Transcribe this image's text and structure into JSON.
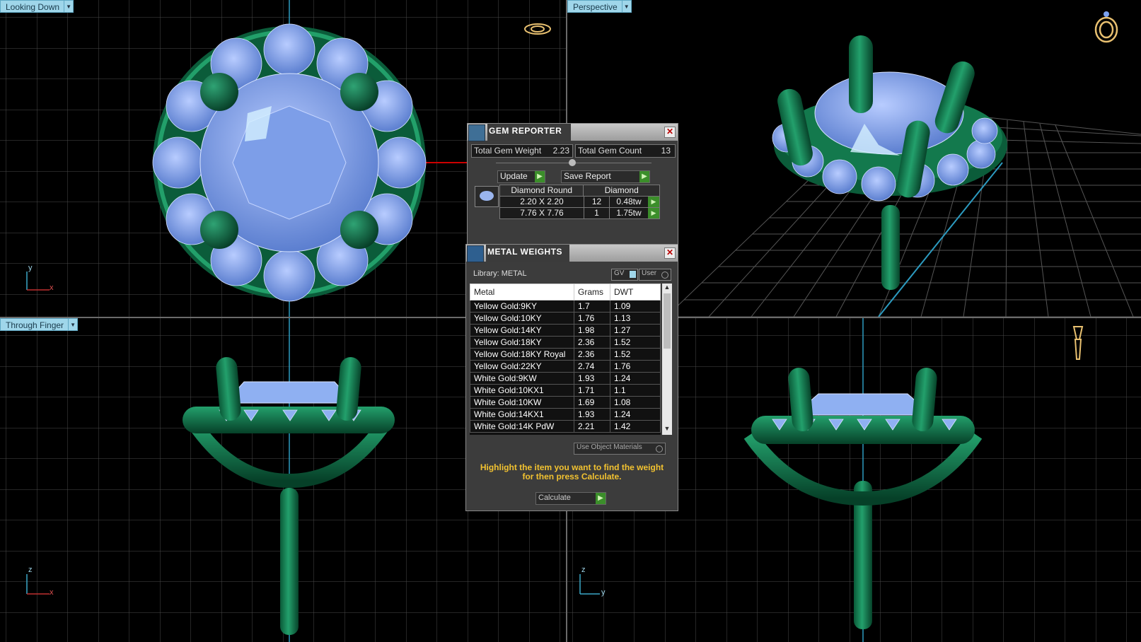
{
  "viewports": {
    "top_left": {
      "label": "Looking Down",
      "axes": [
        "y",
        "x"
      ]
    },
    "top_right": {
      "label": "Perspective"
    },
    "bottom_left": {
      "label": "Through Finger",
      "axes": [
        "z",
        "x"
      ]
    },
    "bottom_right": {
      "axes": [
        "z",
        "y"
      ]
    }
  },
  "gem_reporter": {
    "title": "GEM REPORTER",
    "total_weight_label": "Total Gem Weight",
    "total_weight_value": "2.23",
    "total_count_label": "Total Gem Count",
    "total_count_value": "13",
    "update_label": "Update",
    "save_report_label": "Save Report",
    "header_shape": "Diamond Round",
    "header_material": "Diamond",
    "rows": [
      {
        "size": "2.20 X 2.20",
        "count": "12",
        "weight": "0.48tw"
      },
      {
        "size": "7.76 X 7.76",
        "count": "1",
        "weight": "1.75tw"
      }
    ]
  },
  "metal_weights": {
    "title": "METAL WEIGHTS",
    "library_label": "Library: METAL",
    "gv_label": "GV",
    "user_label": "User",
    "columns": [
      "Metal",
      "Grams",
      "DWT"
    ],
    "rows": [
      {
        "metal": "Yellow Gold:9KY",
        "grams": "1.7",
        "dwt": "1.09"
      },
      {
        "metal": "Yellow Gold:10KY",
        "grams": "1.76",
        "dwt": "1.13"
      },
      {
        "metal": "Yellow Gold:14KY",
        "grams": "1.98",
        "dwt": "1.27"
      },
      {
        "metal": "Yellow Gold:18KY",
        "grams": "2.36",
        "dwt": "1.52"
      },
      {
        "metal": "Yellow Gold:18KY Royal",
        "grams": "2.36",
        "dwt": "1.52"
      },
      {
        "metal": "Yellow Gold:22KY",
        "grams": "2.74",
        "dwt": "1.76"
      },
      {
        "metal": "White Gold:9KW",
        "grams": "1.93",
        "dwt": "1.24"
      },
      {
        "metal": "White Gold:10KX1",
        "grams": "1.71",
        "dwt": "1.1"
      },
      {
        "metal": "White Gold:10KW",
        "grams": "1.69",
        "dwt": "1.08"
      },
      {
        "metal": "White Gold:14KX1",
        "grams": "1.93",
        "dwt": "1.24"
      },
      {
        "metal": "White Gold:14K PdW",
        "grams": "2.21",
        "dwt": "1.42"
      }
    ],
    "use_object_materials_label": "Use Object Materials",
    "hint_line1": "Highlight the item you want to find the weight",
    "hint_line2": "for then press Calculate.",
    "calculate_label": "Calculate"
  },
  "colors": {
    "metal": "#0d6b45",
    "gem": "#8fb0f2",
    "grid": "#4a4a4a",
    "axis": "#3aa8c8",
    "hint": "#f2c230"
  }
}
